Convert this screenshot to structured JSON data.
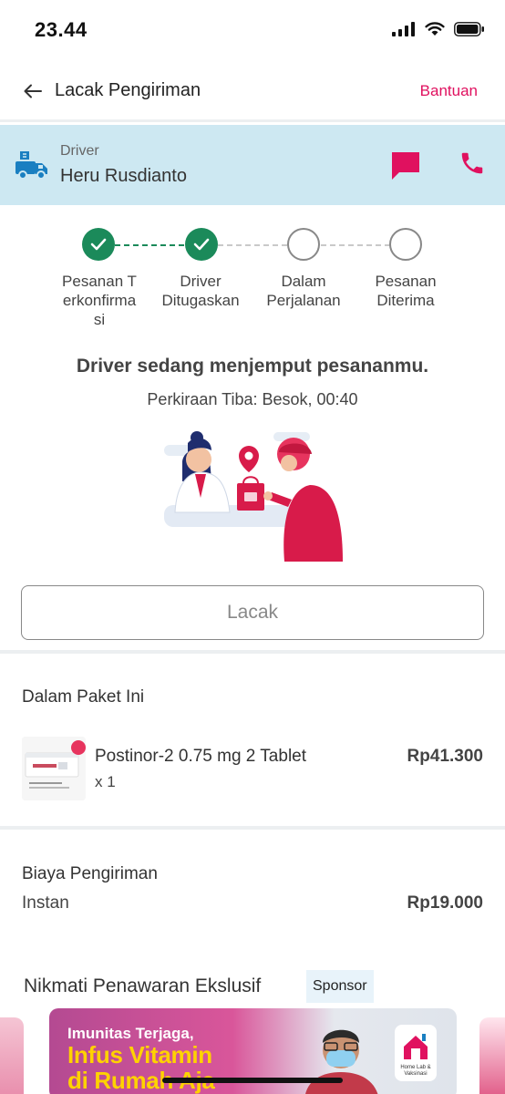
{
  "status_bar": {
    "time": "23.44"
  },
  "header": {
    "title": "Lacak Pengiriman",
    "help_label": "Bantuan"
  },
  "driver": {
    "role": "Driver",
    "name": "Heru Rusdianto"
  },
  "stepper": {
    "steps": [
      {
        "label": "Pesanan Terkonfirmasi",
        "state": "done"
      },
      {
        "label": "Driver Ditugaskan",
        "state": "done"
      },
      {
        "label": "Dalam Perjalanan",
        "state": "pending"
      },
      {
        "label": "Pesanan Diterima",
        "state": "pending"
      }
    ]
  },
  "status": {
    "title": "Driver sedang menjemput pesananmu.",
    "eta": "Perkiraan Tiba: Besok, 00:40"
  },
  "track_button": {
    "label": "Lacak"
  },
  "package": {
    "section_title": "Dalam Paket Ini",
    "items": [
      {
        "name": "Postinor-2 0.75 mg 2 Tablet",
        "qty": "x 1",
        "price": "Rp41.300"
      }
    ]
  },
  "shipping": {
    "section_title": "Biaya Pengiriman",
    "type": "Instan",
    "price": "Rp19.000"
  },
  "promo": {
    "title": "Nikmati Penawaran Ekslusif",
    "sponsor_label": "Sponsor",
    "banner": {
      "line1": "Imunitas Terjaga,",
      "line2": "Infus Vitamin",
      "line3": "di Rumah Aja",
      "logo_text": "Home Lab & Vaksinasi"
    }
  },
  "colors": {
    "accent": "#e0115f",
    "success": "#1b8a5a",
    "driver_bg": "#cde8f2"
  }
}
